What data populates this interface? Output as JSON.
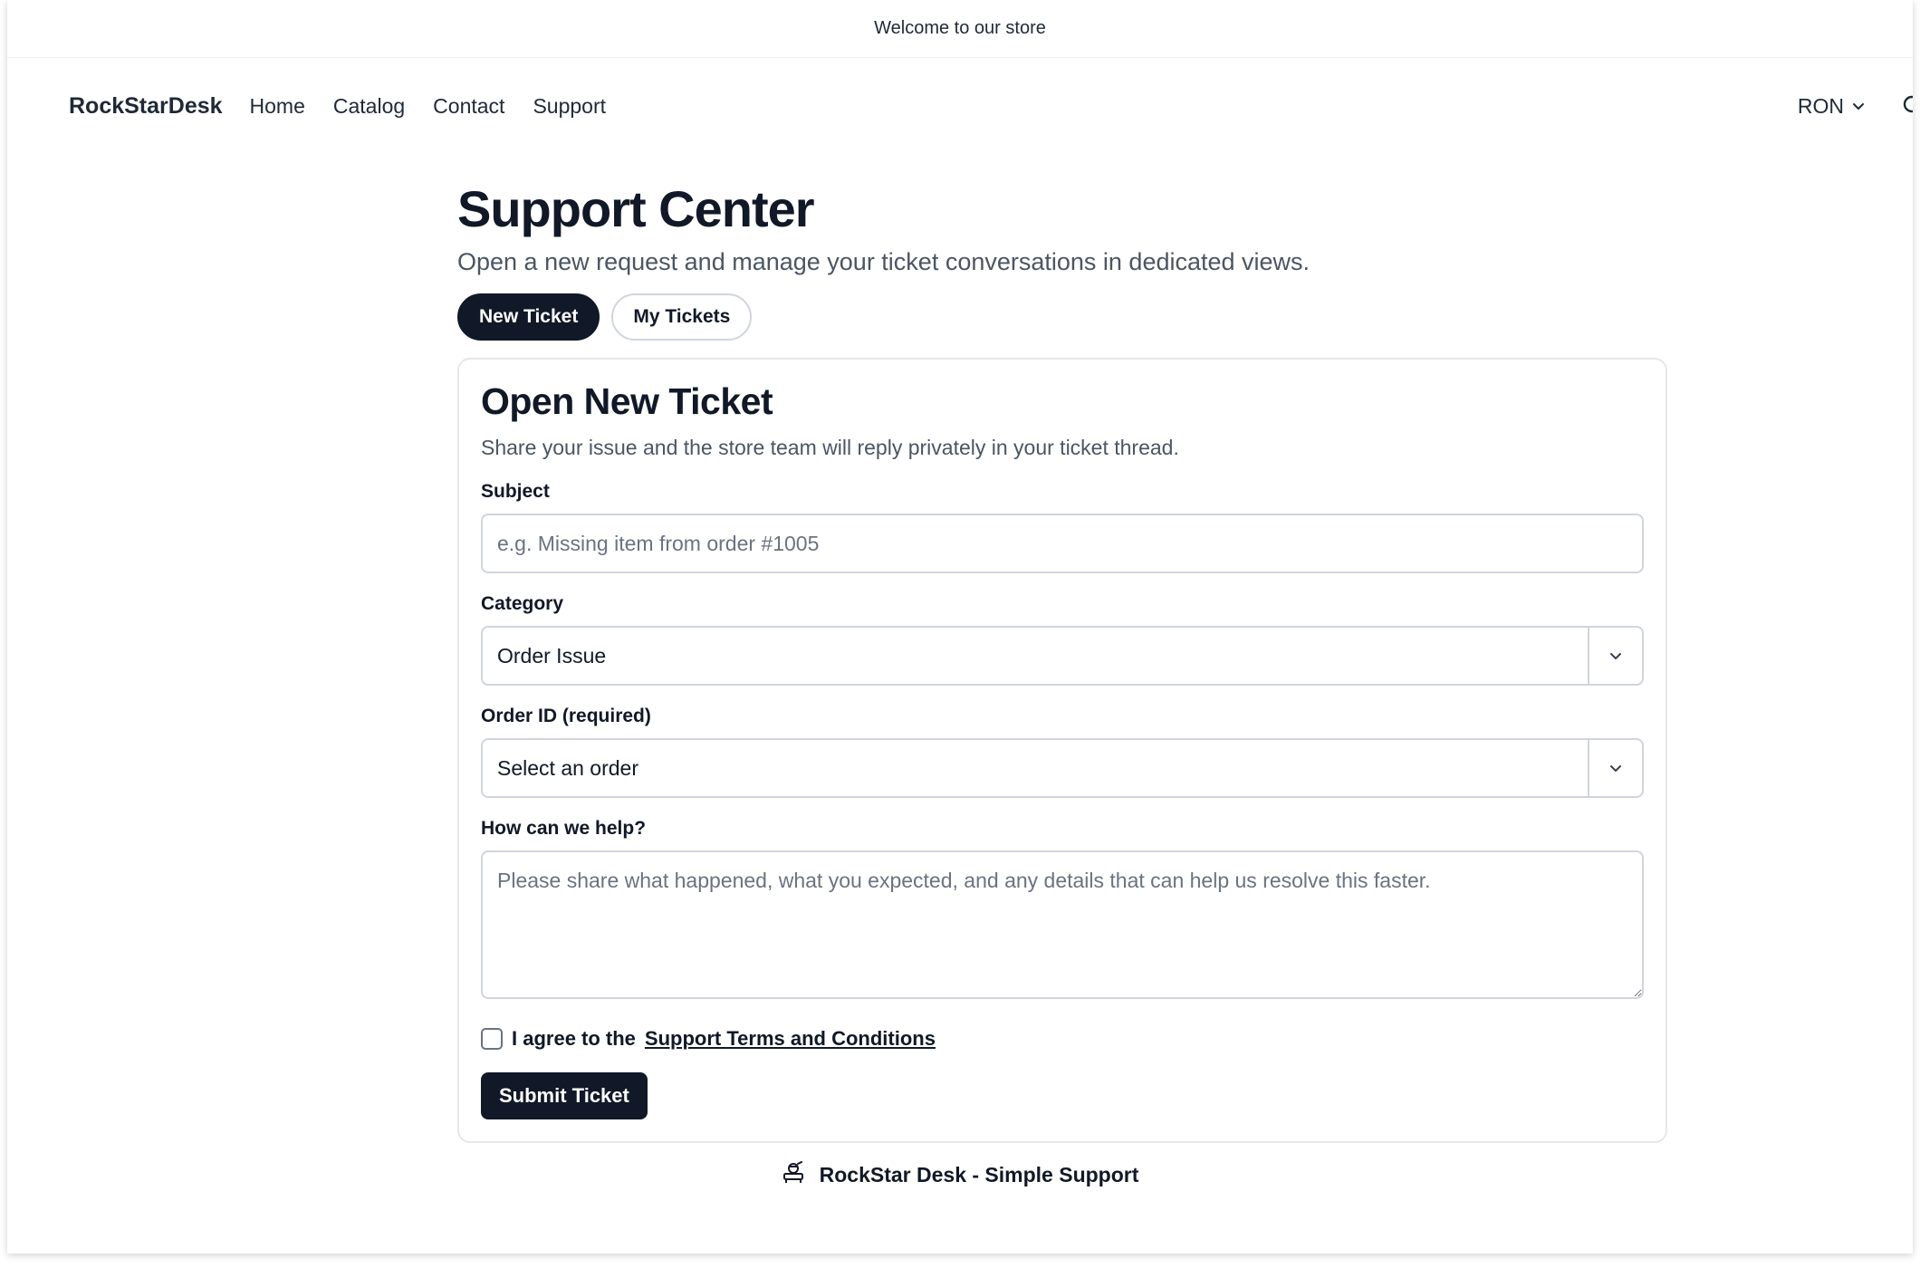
{
  "announcement": {
    "text": "Welcome to our store"
  },
  "header": {
    "brand": "RockStarDesk",
    "nav": [
      "Home",
      "Catalog",
      "Contact",
      "Support"
    ],
    "currency": "RON",
    "icons": {
      "currency_chevron": "chevron-down-icon",
      "search": "search-icon"
    }
  },
  "main": {
    "title": "Support Center",
    "subtitle": "Open a new request and manage your ticket conversations in dedicated views.",
    "tabs": [
      {
        "label": "New Ticket",
        "active": true
      },
      {
        "label": "My Tickets",
        "active": false
      }
    ]
  },
  "form": {
    "title": "Open New Ticket",
    "subtitle": "Share your issue and the store team will reply privately in your ticket thread.",
    "subject": {
      "label": "Subject",
      "value": "",
      "placeholder": "e.g. Missing item from order #1005"
    },
    "category": {
      "label": "Category",
      "selected": "Order Issue"
    },
    "order_id": {
      "label": "Order ID (required)",
      "selected": "Select an order"
    },
    "message": {
      "label": "How can we help?",
      "value": "",
      "placeholder": "Please share what happened, what you expected, and any details that can help us resolve this faster."
    },
    "agree": {
      "prefix": "I agree to the",
      "link": "Support Terms and Conditions",
      "checked": false
    },
    "submit_label": "Submit Ticket"
  },
  "footer": {
    "text": "RockStar Desk - Simple Support",
    "icon": "rockstar-desk-logo-icon"
  },
  "colors": {
    "primary": "#111827",
    "muted_text": "#4b5563",
    "border": "#d1d5db",
    "card_border": "#e5e7eb"
  }
}
